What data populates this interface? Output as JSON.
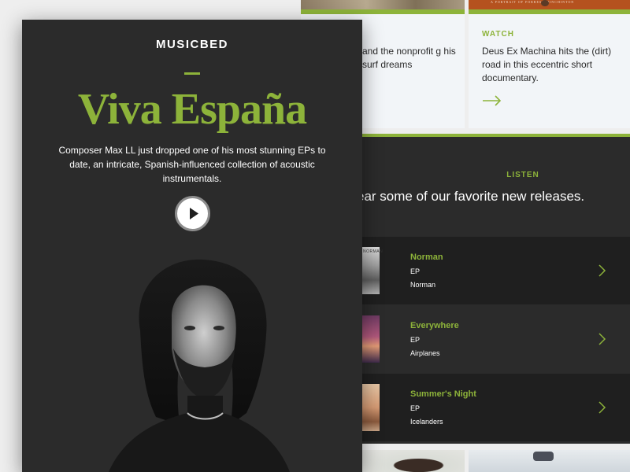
{
  "background_page": {
    "top_images": {
      "right_caption": "A PORTRAIT OF    FORREST MINCHINTON"
    },
    "article_left": {
      "text": "and the nonprofit g his surf dreams"
    },
    "article_right": {
      "label": "WATCH",
      "text": "Deus Ex Machina hits the (dirt) road in this eccentric short documentary.",
      "arrow_icon": "right-arrow-icon"
    },
    "listen": {
      "label": "LISTEN",
      "heading": "ear some of our favorite new releases.",
      "releases": [
        {
          "title": "Norman",
          "type": "EP",
          "artist": "Norman",
          "thumb_text": "NORMAN"
        },
        {
          "title": "Everywhere",
          "type": "EP",
          "artist": "Airplanes"
        },
        {
          "title": "Summer's Night",
          "type": "EP",
          "artist": "Icelanders"
        }
      ]
    }
  },
  "email": {
    "brand": "MUSICBED",
    "headline": "Viva España",
    "description": "Composer Max LL just dropped one of his most stunning EPs to date, an intricate, Spanish-influenced collection of acoustic instrumentals.",
    "play_icon": "play-icon"
  },
  "colors": {
    "accent": "#8db33a",
    "dark": "#2b2b2b",
    "darker": "#1f1f1f",
    "light_card": "#f2f5f8"
  }
}
